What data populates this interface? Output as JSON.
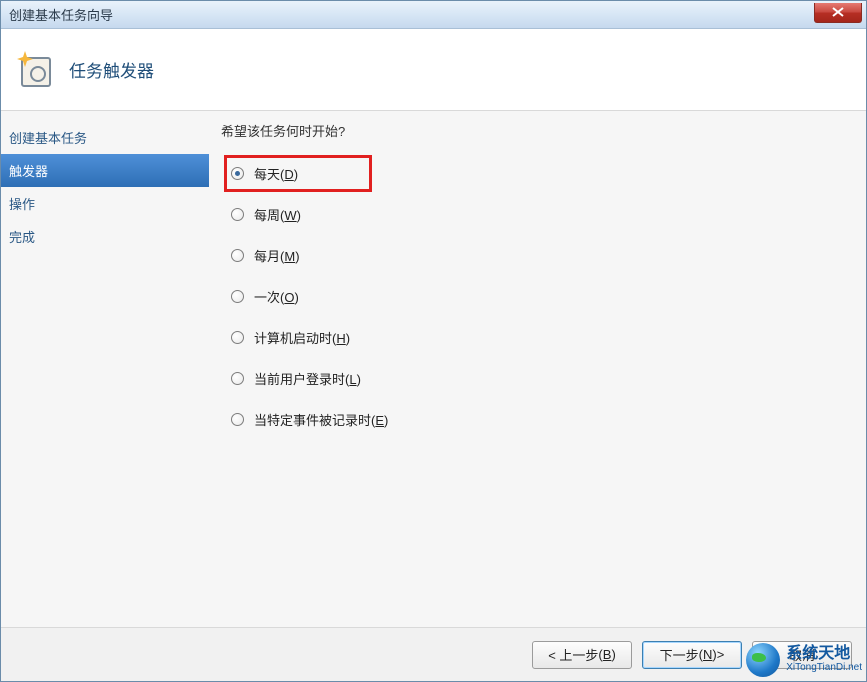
{
  "window": {
    "title": "创建基本任务向导"
  },
  "header": {
    "title": "任务触发器"
  },
  "sidebar": {
    "steps": [
      {
        "label": "创建基本任务",
        "active": false
      },
      {
        "label": "触发器",
        "active": true
      },
      {
        "label": "操作",
        "active": false
      },
      {
        "label": "完成",
        "active": false
      }
    ]
  },
  "content": {
    "question": "希望该任务何时开始?",
    "options": [
      {
        "label": "每天",
        "accel": "D",
        "checked": true,
        "highlight": true
      },
      {
        "label": "每周",
        "accel": "W",
        "checked": false,
        "highlight": false
      },
      {
        "label": "每月",
        "accel": "M",
        "checked": false,
        "highlight": false
      },
      {
        "label": "一次",
        "accel": "O",
        "checked": false,
        "highlight": false
      },
      {
        "label": "计算机启动时",
        "accel": "H",
        "checked": false,
        "highlight": false
      },
      {
        "label": "当前用户登录时",
        "accel": "L",
        "checked": false,
        "highlight": false
      },
      {
        "label": "当特定事件被记录时",
        "accel": "E",
        "checked": false,
        "highlight": false
      }
    ]
  },
  "footer": {
    "back": {
      "label": "< 上一步",
      "accel": "B"
    },
    "next": {
      "label": "下一步",
      "accel": "N",
      "suffix": " >"
    },
    "cancel": {
      "label": "取消"
    }
  },
  "watermark": {
    "line1": "系统天地",
    "line2": "XiTongTianDi.net"
  }
}
